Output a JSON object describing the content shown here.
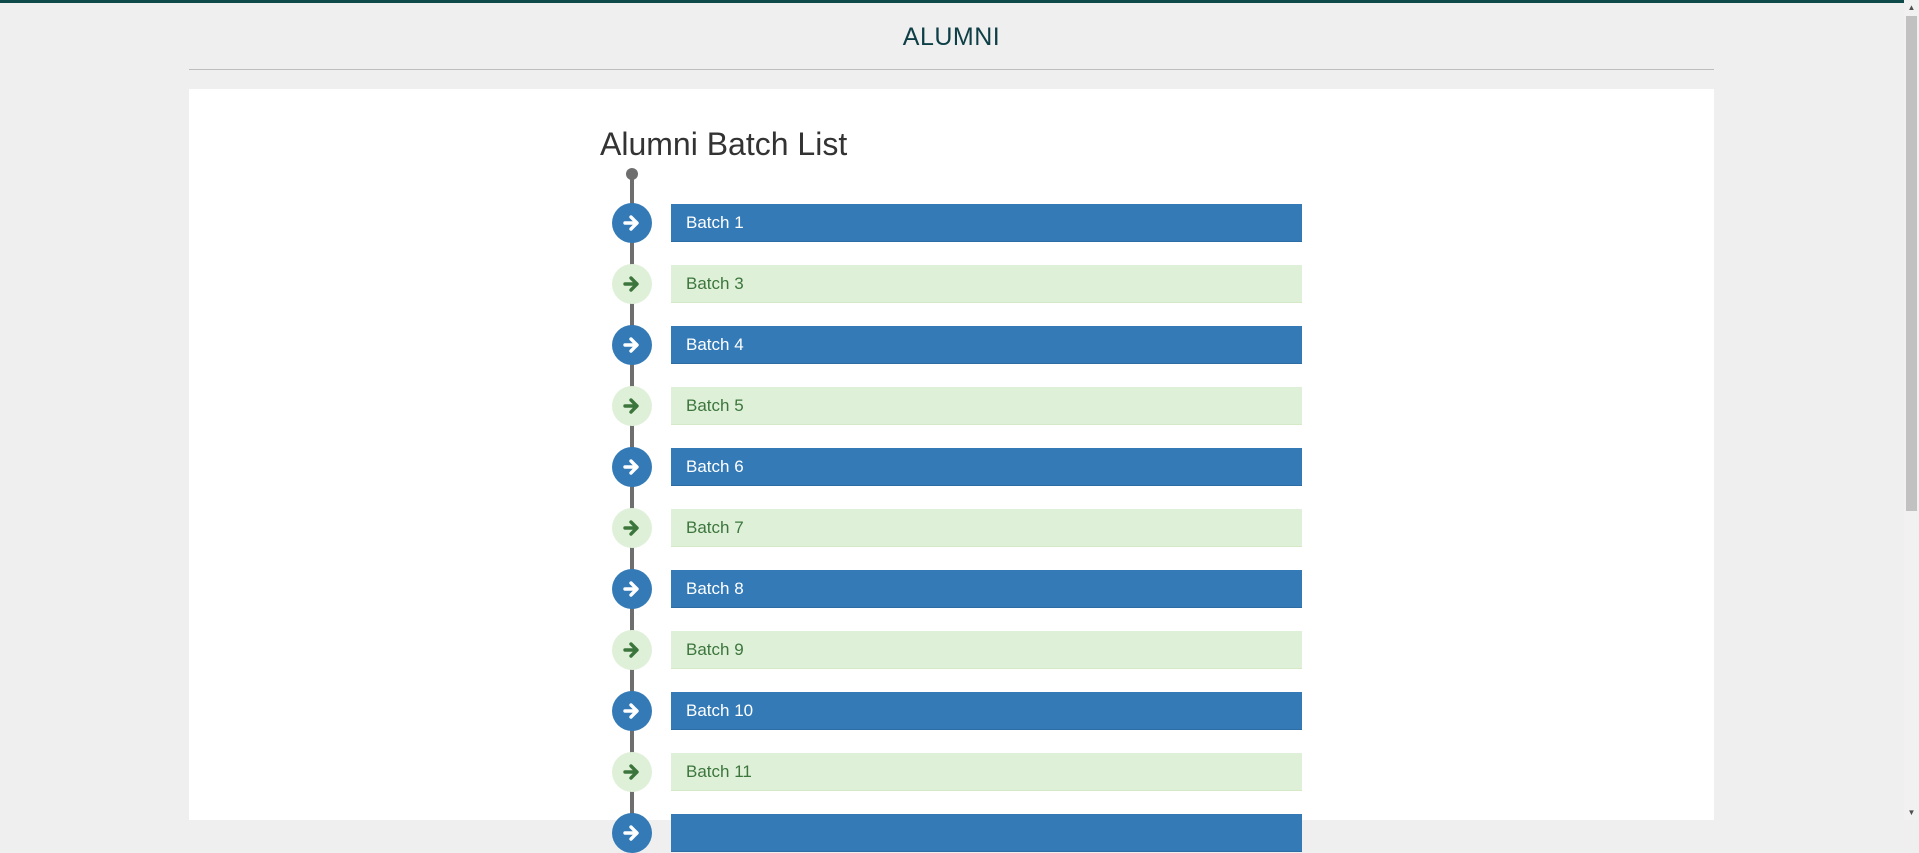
{
  "header": {
    "title": "ALUMNI"
  },
  "main": {
    "page_title": "Alumni Batch List"
  },
  "batches": [
    {
      "label": "Batch 1",
      "style": "primary"
    },
    {
      "label": "Batch 3",
      "style": "success"
    },
    {
      "label": "Batch 4",
      "style": "primary"
    },
    {
      "label": "Batch 5",
      "style": "success"
    },
    {
      "label": "Batch 6",
      "style": "primary"
    },
    {
      "label": "Batch 7",
      "style": "success"
    },
    {
      "label": "Batch 8",
      "style": "primary"
    },
    {
      "label": "Batch 9",
      "style": "success"
    },
    {
      "label": "Batch 10",
      "style": "primary"
    },
    {
      "label": "Batch 11",
      "style": "success"
    },
    {
      "label": "",
      "style": "primary"
    }
  ],
  "colors": {
    "primary": "#337ab7",
    "success_bg": "#dff0d8",
    "success_text": "#3c763d",
    "header_text": "#0e3f47",
    "timeline": "#6e6e6e"
  },
  "icons": {
    "badge": "arrow-right-icon"
  }
}
